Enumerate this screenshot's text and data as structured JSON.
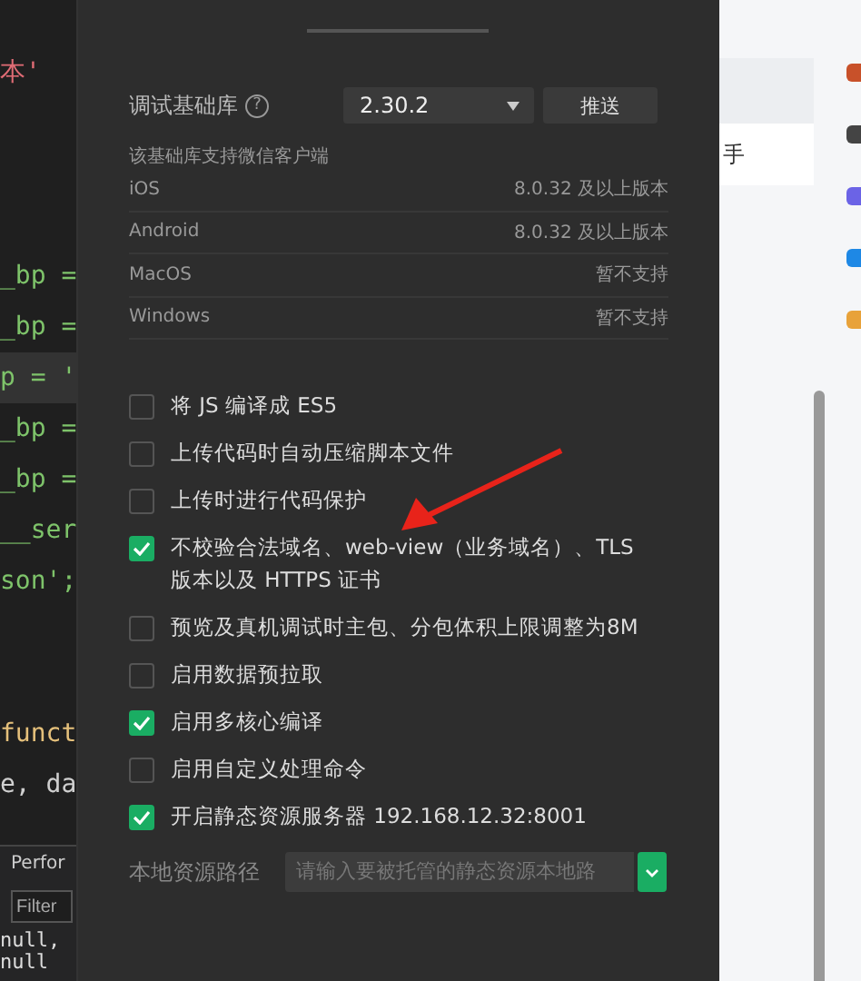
{
  "editor": {
    "lines": [
      {
        "kind": "string",
        "text": "本'",
        "current": false
      },
      {
        "kind": "blank",
        "current": false
      },
      {
        "kind": "blank",
        "current": false
      },
      {
        "kind": "blank",
        "current": false
      },
      {
        "kind": "code",
        "text": "_bp =",
        "current": false
      },
      {
        "kind": "code",
        "text": "_bp =",
        "current": false
      },
      {
        "kind": "code",
        "text": "p = '",
        "current": true
      },
      {
        "kind": "code",
        "text": "_bp =",
        "current": false
      },
      {
        "kind": "code",
        "text": "_bp =",
        "current": false
      },
      {
        "kind": "code",
        "text": "__ser",
        "current": false
      },
      {
        "kind": "code",
        "text": "son';",
        "current": false
      },
      {
        "kind": "blank",
        "current": false
      },
      {
        "kind": "blank",
        "current": false
      },
      {
        "kind": "func",
        "text": "funct",
        "current": false
      },
      {
        "kind": "plain",
        "text": "e, da",
        "current": false
      }
    ],
    "panel": {
      "tab": "Perfor",
      "filter_placeholder": "Filter",
      "output": [
        "null,",
        "null"
      ]
    }
  },
  "settings": {
    "library": {
      "label": "调试基础库",
      "help": "?",
      "version": "2.30.2",
      "push_button": "推送"
    },
    "support": {
      "caption": "该基础库支持微信客户端",
      "rows": [
        {
          "platform": "iOS",
          "requirement": "8.0.32 及以上版本"
        },
        {
          "platform": "Android",
          "requirement": "8.0.32 及以上版本"
        },
        {
          "platform": "MacOS",
          "requirement": "暂不支持"
        },
        {
          "platform": "Windows",
          "requirement": "暂不支持"
        }
      ]
    },
    "options": [
      {
        "label": "将 JS 编译成 ES5",
        "checked": false
      },
      {
        "label": "上传代码时自动压缩脚本文件",
        "checked": false
      },
      {
        "label": "上传时进行代码保护",
        "checked": false
      },
      {
        "label": "不校验合法域名、web-view（业务域名）、TLS 版本以及 HTTPS 证书",
        "checked": true
      },
      {
        "label": "预览及真机调试时主包、分包体积上限调整为8M",
        "checked": false
      },
      {
        "label": "启用数据预拉取",
        "checked": false
      },
      {
        "label": "启用多核心编译",
        "checked": true
      },
      {
        "label": "启用自定义处理命令",
        "checked": false
      },
      {
        "label": "开启静态资源服务器 192.168.12.32:8001",
        "checked": true
      }
    ],
    "resource_path": {
      "label": "本地资源路径",
      "placeholder": "请输入要被托管的静态资源本地路"
    }
  },
  "background": {
    "card_text": "手"
  }
}
